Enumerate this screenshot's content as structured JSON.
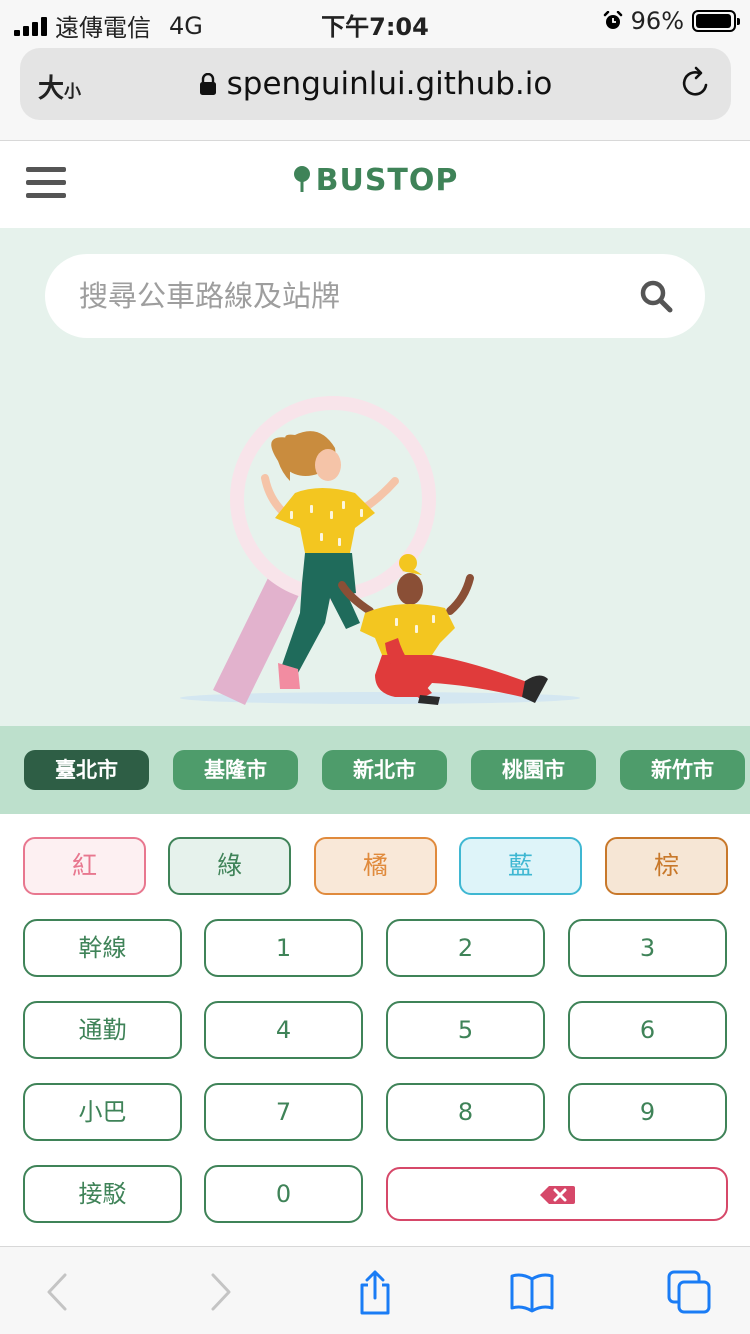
{
  "status_bar": {
    "carrier": "遠傳電信",
    "network": "4G",
    "time": "下午7:04",
    "battery": "96%",
    "battery_level": 0.96
  },
  "browser": {
    "text_size_big": "大",
    "text_size_small": "小",
    "url": "spenguinlui.github.io"
  },
  "header": {
    "logo_text": "BUSTOP"
  },
  "search": {
    "placeholder": "搜尋公車路線及站牌"
  },
  "cities": [
    {
      "label": "臺北市",
      "active": true
    },
    {
      "label": "基隆市",
      "active": false
    },
    {
      "label": "新北市",
      "active": false
    },
    {
      "label": "桃園市",
      "active": false
    },
    {
      "label": "新竹市",
      "active": false
    }
  ],
  "color_keys": [
    {
      "label": "紅",
      "text": "#e8778f",
      "border": "#e8778f",
      "bg": "#fdf0f2"
    },
    {
      "label": "綠",
      "text": "#3f8358",
      "border": "#3f8358",
      "bg": "#e6f2ec"
    },
    {
      "label": "橘",
      "text": "#e08a3c",
      "border": "#e08a3c",
      "bg": "#f9e8d8"
    },
    {
      "label": "藍",
      "text": "#3fb7d2",
      "border": "#3fb7d2",
      "bg": "#def4f9"
    },
    {
      "label": "棕",
      "text": "#c8782a",
      "border": "#c8782a",
      "bg": "#f6e6d5"
    }
  ],
  "keys": {
    "trunk": "幹線",
    "commute": "通勤",
    "minibus": "小巴",
    "shuttle": "接駁",
    "k1": "1",
    "k2": "2",
    "k3": "3",
    "k4": "4",
    "k5": "5",
    "k6": "6",
    "k7": "7",
    "k8": "8",
    "k9": "9",
    "k0": "0"
  },
  "colors": {
    "brand_green": "#3f8358",
    "hero_bg": "#e6f2ec",
    "city_bar_bg": "#bde0cc",
    "city_tab": "#4e9c6b",
    "city_tab_active": "#2e5e45",
    "backspace_red": "#d64869",
    "ios_blue": "#1a7cf5"
  }
}
